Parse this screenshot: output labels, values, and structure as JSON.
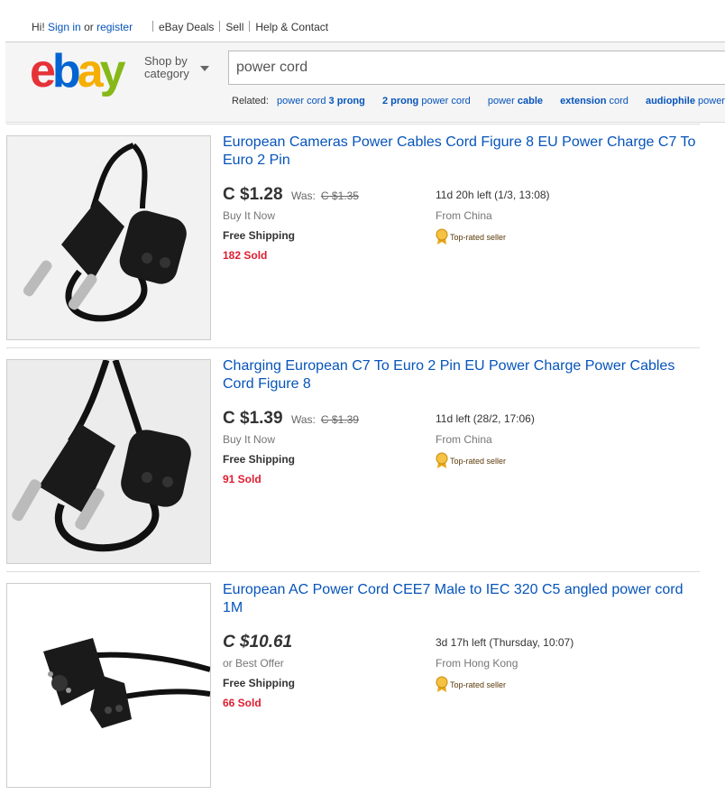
{
  "topbar": {
    "greeting": "Hi!",
    "signin": "Sign in",
    "or": "or",
    "register": "register",
    "nav": [
      "eBay Deals",
      "Sell",
      "Help & Contact"
    ]
  },
  "header": {
    "logo": {
      "e": "e",
      "b": "b",
      "a": "a",
      "y": "y"
    },
    "shop_by_1": "Shop by",
    "shop_by_2": "category",
    "search_value": "power cord",
    "related_label": "Related:",
    "related": [
      {
        "plain": "power cord ",
        "bold": "3 prong",
        "after": ""
      },
      {
        "plain": "",
        "bold": "2 prong",
        "after": " power cord"
      },
      {
        "plain": "power ",
        "bold": "cable",
        "after": ""
      },
      {
        "plain": "",
        "bold": "extension",
        "after": " cord"
      },
      {
        "plain": "",
        "bold": "audiophile",
        "after": " power c"
      }
    ]
  },
  "listings": [
    {
      "title": "European Cameras Power Cables Cord Figure 8 EU Power Charge C7 To Euro 2 Pin",
      "price": "C $1.28",
      "was_label": "Was:",
      "was_price": "C $1.35",
      "format": "Buy It Now",
      "shipping": "Free Shipping",
      "sold": "182 Sold",
      "time_left": "11d 20h left (1/3, 13:08)",
      "from": "From China",
      "badge": "Top-rated seller"
    },
    {
      "title": "Charging European C7 To Euro 2 Pin EU Power Charge Power Cables Cord Figure 8",
      "price": "C $1.39",
      "was_label": "Was:",
      "was_price": "C $1.39",
      "format": "Buy It Now",
      "shipping": "Free Shipping",
      "sold": "91 Sold",
      "time_left": "11d left (28/2, 17:06)",
      "from": "From China",
      "badge": "Top-rated seller"
    },
    {
      "title": "European AC Power Cord CEE7 Male to IEC 320 C5 angled power cord 1M",
      "price": "C $10.61",
      "format": "or Best Offer",
      "shipping": "Free Shipping",
      "sold": "66 Sold",
      "time_left": "3d 17h left (Thursday, 10:07)",
      "from": "From Hong Kong",
      "badge": "Top-rated seller"
    }
  ]
}
